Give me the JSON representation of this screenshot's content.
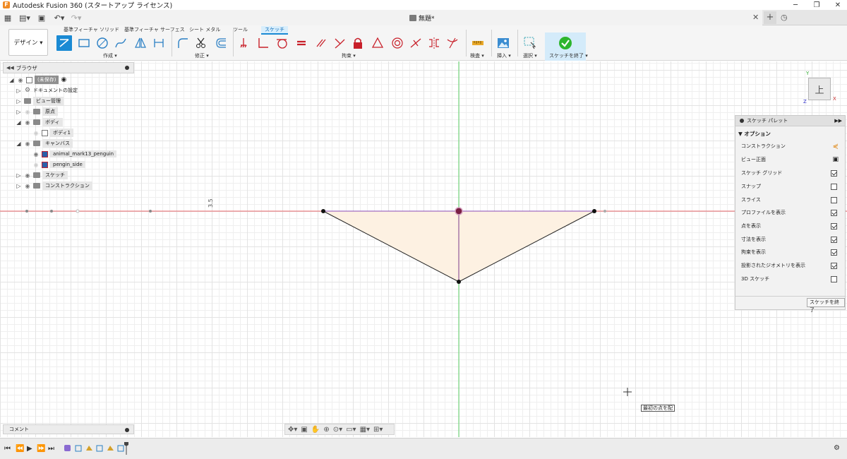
{
  "window": {
    "title": "Autodesk Fusion 360 (スタートアップ ライセンス)"
  },
  "document": {
    "title": "無題*"
  },
  "ribbon": {
    "workspace": "デザイン ▾",
    "tabs": [
      "基準フィーチャ ソリッド",
      "基準フィーチャ サーフェス",
      "シート メタル",
      "ツール",
      "スケッチ"
    ],
    "groups": {
      "create": "作成 ▾",
      "modify": "修正 ▾",
      "constraints": "拘束 ▾",
      "inspect": "検査 ▾",
      "insert": "挿入 ▾",
      "select": "選択 ▾",
      "finish": "スケッチを終了 ▾"
    }
  },
  "browser": {
    "title": "ブラウザ",
    "root": "(未保存)",
    "items": [
      {
        "label": "ドキュメントの設定"
      },
      {
        "label": "ビュー管理"
      },
      {
        "label": "原点"
      },
      {
        "label": "ボディ"
      },
      {
        "label": "ボディ1"
      },
      {
        "label": "キャンバス"
      },
      {
        "label": "animal_mark13_penguin"
      },
      {
        "label": "pengin_side"
      },
      {
        "label": "スケッチ"
      },
      {
        "label": "コンストラクション"
      }
    ]
  },
  "comments": {
    "label": "コメント"
  },
  "canvas": {
    "dimension_text": "3.5",
    "colors": {
      "x_axis": "#e8646a",
      "y_axis": "#5fd36a",
      "profile_fill": "#fdf1e2",
      "line": "#222222",
      "center_point": "#7a1f45"
    }
  },
  "viewcube": {
    "face": "上",
    "axis_y": "Y",
    "axis_x": "X",
    "axis_z": "Z"
  },
  "palette": {
    "title": "スケッチ パレット",
    "section": "▼ オプション",
    "rows": [
      {
        "label": "コンストラクション",
        "checked": false
      },
      {
        "label": "ビュー正面",
        "checked": false
      },
      {
        "label": "スケッチ グリッド",
        "checked": true
      },
      {
        "label": "スナップ",
        "checked": false
      },
      {
        "label": "スライス",
        "checked": false
      },
      {
        "label": "プロファイルを表示",
        "checked": true
      },
      {
        "label": "点を表示",
        "checked": true
      },
      {
        "label": "寸法を表示",
        "checked": true
      },
      {
        "label": "拘束を表示",
        "checked": true
      },
      {
        "label": "投影されたジオメトリを表示",
        "checked": true
      },
      {
        "label": "3D スケッチ",
        "checked": false
      }
    ],
    "finish_button": "スケッチを終了"
  },
  "tooltip": {
    "text": "最初の点を配"
  }
}
